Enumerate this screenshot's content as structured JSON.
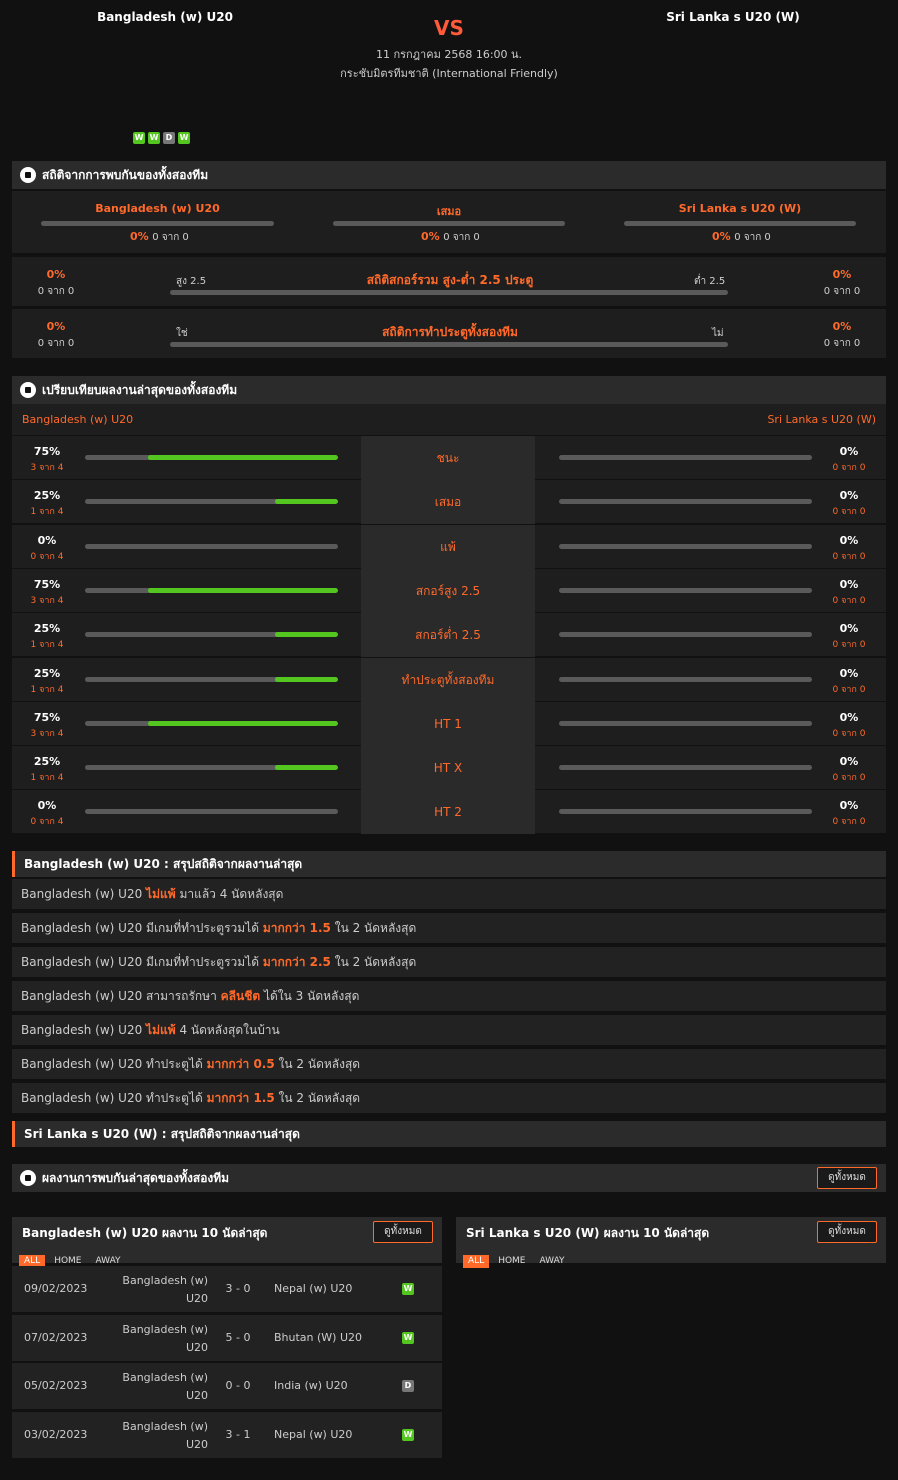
{
  "header": {
    "home": "Bangladesh (w) U20",
    "away": "Sri Lanka s U20 (W)",
    "vs": "VS",
    "datetime": "11 กรกฎาคม 2568 16:00 น.",
    "competition": "กระชับมิตรทีมชาติ (International Friendly)",
    "form": [
      "W",
      "W",
      "D",
      "W"
    ]
  },
  "h2h": {
    "title": "สถิติจากการพบกันของทั้งสองทีม",
    "cols": [
      {
        "label": "Bangladesh (w) U20",
        "pct": "0%",
        "sub": "0 จาก 0"
      },
      {
        "label": "เสมอ",
        "pct": "0%",
        "sub": "0 จาก 0"
      },
      {
        "label": "Sri Lanka s U20 (W)",
        "pct": "0%",
        "sub": "0 จาก 0"
      }
    ],
    "ou": {
      "title": "สถิติสกอร์รวม สูง-ต่ำ 2.5 ประตู",
      "left": "สูง 2.5",
      "right": "ต่ำ 2.5",
      "lpct": "0%",
      "lsub": "0 จาก 0",
      "rpct": "0%",
      "rsub": "0 จาก 0"
    },
    "btts": {
      "title": "สถิติการทำประตูทั้งสองทีม",
      "left": "ใช่",
      "right": "ไม่",
      "lpct": "0%",
      "lsub": "0 จาก 0",
      "rpct": "0%",
      "rsub": "0 จาก 0"
    }
  },
  "compare": {
    "title": "เปรียบเทียบผลงานล่าสุดของทั้งสองทีม",
    "home": "Bangladesh (w) U20",
    "away": "Sri Lanka s U20 (W)",
    "rows": [
      {
        "label": "ชนะ",
        "lpct": "75%",
        "lsub": "3 จาก 4",
        "lval": 0.75,
        "rpct": "0%",
        "rsub": "0 จาก 0",
        "rval": 0
      },
      {
        "label": "เสมอ",
        "lpct": "25%",
        "lsub": "1 จาก 4",
        "lval": 0.25,
        "rpct": "0%",
        "rsub": "0 จาก 0",
        "rval": 0
      },
      {
        "label": "แพ้",
        "lpct": "0%",
        "lsub": "0 จาก 4",
        "lval": 0,
        "rpct": "0%",
        "rsub": "0 จาก 0",
        "rval": 0
      },
      {
        "label": "สกอร์สูง 2.5",
        "lpct": "75%",
        "lsub": "3 จาก 4",
        "lval": 0.75,
        "rpct": "0%",
        "rsub": "0 จาก 0",
        "rval": 0
      },
      {
        "label": "สกอร์ต่ำ 2.5",
        "lpct": "25%",
        "lsub": "1 จาก 4",
        "lval": 0.25,
        "rpct": "0%",
        "rsub": "0 จาก 0",
        "rval": 0
      },
      {
        "label": "ทำประตูทั้งสองทีม",
        "lpct": "25%",
        "lsub": "1 จาก 4",
        "lval": 0.25,
        "rpct": "0%",
        "rsub": "0 จาก 0",
        "rval": 0
      },
      {
        "label": "HT 1",
        "lpct": "75%",
        "lsub": "3 จาก 4",
        "lval": 0.75,
        "rpct": "0%",
        "rsub": "0 จาก 0",
        "rval": 0
      },
      {
        "label": "HT X",
        "lpct": "25%",
        "lsub": "1 จาก 4",
        "lval": 0.25,
        "rpct": "0%",
        "rsub": "0 จาก 0",
        "rval": 0
      },
      {
        "label": "HT 2",
        "lpct": "0%",
        "lsub": "0 จาก 4",
        "lval": 0,
        "rpct": "0%",
        "rsub": "0 จาก 0",
        "rval": 0
      }
    ]
  },
  "summary_home": {
    "title": "Bangladesh (w) U20 : สรุปสถิติจากผลงานล่าสุด",
    "rows": [
      {
        "a": "Bangladesh (w) U20 ",
        "b": "ไม่แพ้",
        "c": " มาแล้ว 4 นัดหลังสุด"
      },
      {
        "a": "Bangladesh (w) U20 มีเกมที่ทำประตูรวมได้ ",
        "b": "มากกว่า 1.5",
        "c": " ใน 2 นัดหลังสุด"
      },
      {
        "a": "Bangladesh (w) U20 มีเกมที่ทำประตูรวมได้ ",
        "b": "มากกว่า 2.5",
        "c": " ใน 2 นัดหลังสุด"
      },
      {
        "a": "Bangladesh (w) U20 สามารถรักษา ",
        "b": "คลีนชีต",
        "c": " ได้ใน 3 นัดหลังสุด"
      },
      {
        "a": "Bangladesh (w) U20 ",
        "b": "ไม่แพ้",
        "c": " 4 นัดหลังสุดในบ้าน"
      },
      {
        "a": "Bangladesh (w) U20 ทำประตูได้ ",
        "b": "มากกว่า 0.5",
        "c": " ใน 2 นัดหลังสุด"
      },
      {
        "a": "Bangladesh (w) U20 ทำประตูได้ ",
        "b": "มากกว่า 1.5",
        "c": " ใน 2 นัดหลังสุด"
      }
    ]
  },
  "summary_away": {
    "title": "Sri Lanka s U20 (W) : สรุปสถิติจากผลงานล่าสุด"
  },
  "recent": {
    "title": "ผลงานการพบกันล่าสุดของทั้งสองทีม",
    "view_all": "ดูทั้งหมด",
    "home_title": "Bangladesh (w) U20 ผลงาน 10 นัดล่าสุด",
    "away_title": "Sri Lanka s U20 (W) ผลงาน 10 นัดล่าสุด",
    "tabs": [
      "ALL",
      "HOME",
      "AWAY"
    ],
    "matches": [
      {
        "date": "09/02/2023",
        "home": "Bangladesh (w) U20",
        "score": "3 - 0",
        "away": "Nepal (w) U20",
        "res": "W"
      },
      {
        "date": "07/02/2023",
        "home": "Bangladesh (w) U20",
        "score": "5 - 0",
        "away": "Bhutan (W) U20",
        "res": "W"
      },
      {
        "date": "05/02/2023",
        "home": "Bangladesh (w) U20",
        "score": "0 - 0",
        "away": "India (w) U20",
        "res": "D"
      },
      {
        "date": "03/02/2023",
        "home": "Bangladesh (w) U20",
        "score": "3 - 1",
        "away": "Nepal (w) U20",
        "res": "W"
      }
    ]
  }
}
